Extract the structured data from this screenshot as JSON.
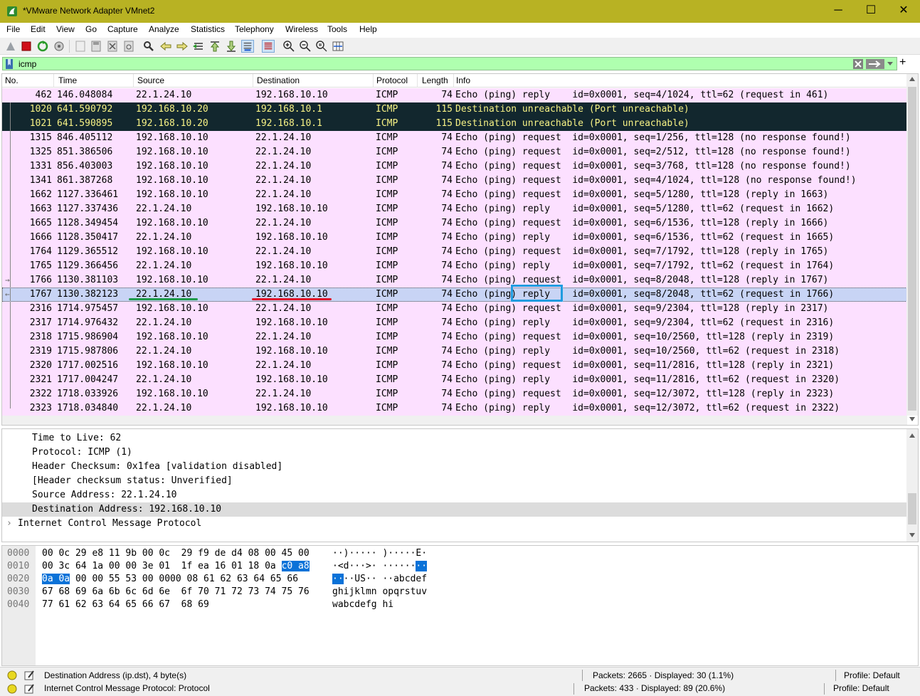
{
  "window": {
    "title": "*VMware Network Adapter VMnet2",
    "minimize": "─",
    "maximize": "☐",
    "close": "✕"
  },
  "menu": [
    "File",
    "Edit",
    "View",
    "Go",
    "Capture",
    "Analyze",
    "Statistics",
    "Telephony",
    "Wireless",
    "Tools",
    "Help"
  ],
  "filter": {
    "value": "icmp",
    "plus": "+"
  },
  "columns": [
    "No.",
    "Time",
    "Source",
    "Destination",
    "Protocol",
    "Length",
    "Info"
  ],
  "packets": [
    {
      "no": "462",
      "time": "146.048084",
      "src": "22.1.24.10",
      "dst": "192.168.10.10",
      "proto": "ICMP",
      "len": "74",
      "info": "Echo (ping) reply    id=0x0001, seq=4/1024, ttl=62 (request in 461)",
      "style": "pink"
    },
    {
      "no": "1020",
      "time": "641.590792",
      "src": "192.168.10.20",
      "dst": "192.168.10.1",
      "proto": "ICMP",
      "len": "115",
      "info": "Destination unreachable (Port unreachable)",
      "style": "dark"
    },
    {
      "no": "1021",
      "time": "641.590895",
      "src": "192.168.10.20",
      "dst": "192.168.10.1",
      "proto": "ICMP",
      "len": "115",
      "info": "Destination unreachable (Port unreachable)",
      "style": "dark"
    },
    {
      "no": "1315",
      "time": "846.405112",
      "src": "192.168.10.10",
      "dst": "22.1.24.10",
      "proto": "ICMP",
      "len": "74",
      "info": "Echo (ping) request  id=0x0001, seq=1/256, ttl=128 (no response found!)",
      "style": "pink"
    },
    {
      "no": "1325",
      "time": "851.386506",
      "src": "192.168.10.10",
      "dst": "22.1.24.10",
      "proto": "ICMP",
      "len": "74",
      "info": "Echo (ping) request  id=0x0001, seq=2/512, ttl=128 (no response found!)",
      "style": "pink"
    },
    {
      "no": "1331",
      "time": "856.403003",
      "src": "192.168.10.10",
      "dst": "22.1.24.10",
      "proto": "ICMP",
      "len": "74",
      "info": "Echo (ping) request  id=0x0001, seq=3/768, ttl=128 (no response found!)",
      "style": "pink"
    },
    {
      "no": "1341",
      "time": "861.387268",
      "src": "192.168.10.10",
      "dst": "22.1.24.10",
      "proto": "ICMP",
      "len": "74",
      "info": "Echo (ping) request  id=0x0001, seq=4/1024, ttl=128 (no response found!)",
      "style": "pink"
    },
    {
      "no": "1662",
      "time": "1127.336461",
      "src": "192.168.10.10",
      "dst": "22.1.24.10",
      "proto": "ICMP",
      "len": "74",
      "info": "Echo (ping) request  id=0x0001, seq=5/1280, ttl=128 (reply in 1663)",
      "style": "pink"
    },
    {
      "no": "1663",
      "time": "1127.337436",
      "src": "22.1.24.10",
      "dst": "192.168.10.10",
      "proto": "ICMP",
      "len": "74",
      "info": "Echo (ping) reply    id=0x0001, seq=5/1280, ttl=62 (request in 1662)",
      "style": "pink"
    },
    {
      "no": "1665",
      "time": "1128.349454",
      "src": "192.168.10.10",
      "dst": "22.1.24.10",
      "proto": "ICMP",
      "len": "74",
      "info": "Echo (ping) request  id=0x0001, seq=6/1536, ttl=128 (reply in 1666)",
      "style": "pink"
    },
    {
      "no": "1666",
      "time": "1128.350417",
      "src": "22.1.24.10",
      "dst": "192.168.10.10",
      "proto": "ICMP",
      "len": "74",
      "info": "Echo (ping) reply    id=0x0001, seq=6/1536, ttl=62 (request in 1665)",
      "style": "pink"
    },
    {
      "no": "1764",
      "time": "1129.365512",
      "src": "192.168.10.10",
      "dst": "22.1.24.10",
      "proto": "ICMP",
      "len": "74",
      "info": "Echo (ping) request  id=0x0001, seq=7/1792, ttl=128 (reply in 1765)",
      "style": "pink"
    },
    {
      "no": "1765",
      "time": "1129.366456",
      "src": "22.1.24.10",
      "dst": "192.168.10.10",
      "proto": "ICMP",
      "len": "74",
      "info": "Echo (ping) reply    id=0x0001, seq=7/1792, ttl=62 (request in 1764)",
      "style": "pink"
    },
    {
      "no": "1766",
      "time": "1130.381103",
      "src": "192.168.10.10",
      "dst": "22.1.24.10",
      "proto": "ICMP",
      "len": "74",
      "info": "Echo (ping) request  id=0x0001, seq=8/2048, ttl=128 (reply in 1767)",
      "style": "pink"
    },
    {
      "no": "1767",
      "time": "1130.382123",
      "src": "22.1.24.10",
      "dst": "192.168.10.10",
      "proto": "ICMP",
      "len": "74",
      "info": "Echo (ping) reply    id=0x0001, seq=8/2048, ttl=62 (request in 1766)",
      "style": "selected"
    },
    {
      "no": "2316",
      "time": "1714.975457",
      "src": "192.168.10.10",
      "dst": "22.1.24.10",
      "proto": "ICMP",
      "len": "74",
      "info": "Echo (ping) request  id=0x0001, seq=9/2304, ttl=128 (reply in 2317)",
      "style": "pink"
    },
    {
      "no": "2317",
      "time": "1714.976432",
      "src": "22.1.24.10",
      "dst": "192.168.10.10",
      "proto": "ICMP",
      "len": "74",
      "info": "Echo (ping) reply    id=0x0001, seq=9/2304, ttl=62 (request in 2316)",
      "style": "pink"
    },
    {
      "no": "2318",
      "time": "1715.986904",
      "src": "192.168.10.10",
      "dst": "22.1.24.10",
      "proto": "ICMP",
      "len": "74",
      "info": "Echo (ping) request  id=0x0001, seq=10/2560, ttl=128 (reply in 2319)",
      "style": "pink"
    },
    {
      "no": "2319",
      "time": "1715.987806",
      "src": "22.1.24.10",
      "dst": "192.168.10.10",
      "proto": "ICMP",
      "len": "74",
      "info": "Echo (ping) reply    id=0x0001, seq=10/2560, ttl=62 (request in 2318)",
      "style": "pink"
    },
    {
      "no": "2320",
      "time": "1717.002516",
      "src": "192.168.10.10",
      "dst": "22.1.24.10",
      "proto": "ICMP",
      "len": "74",
      "info": "Echo (ping) request  id=0x0001, seq=11/2816, ttl=128 (reply in 2321)",
      "style": "pink"
    },
    {
      "no": "2321",
      "time": "1717.004247",
      "src": "22.1.24.10",
      "dst": "192.168.10.10",
      "proto": "ICMP",
      "len": "74",
      "info": "Echo (ping) reply    id=0x0001, seq=11/2816, ttl=62 (request in 2320)",
      "style": "pink"
    },
    {
      "no": "2322",
      "time": "1718.033926",
      "src": "192.168.10.10",
      "dst": "22.1.24.10",
      "proto": "ICMP",
      "len": "74",
      "info": "Echo (ping) request  id=0x0001, seq=12/3072, ttl=128 (reply in 2323)",
      "style": "pink"
    },
    {
      "no": "2323",
      "time": "1718.034840",
      "src": "22.1.24.10",
      "dst": "192.168.10.10",
      "proto": "ICMP",
      "len": "74",
      "info": "Echo (ping) reply    id=0x0001, seq=12/3072, ttl=62 (request in 2322)",
      "style": "pink"
    }
  ],
  "details": [
    {
      "text": "Time to Live: 62",
      "indent": 1,
      "selected": false
    },
    {
      "text": "Protocol: ICMP (1)",
      "indent": 1,
      "selected": false
    },
    {
      "text": "Header Checksum: 0x1fea [validation disabled]",
      "indent": 1,
      "selected": false
    },
    {
      "text": "[Header checksum status: Unverified]",
      "indent": 1,
      "selected": false
    },
    {
      "text": "Source Address: 22.1.24.10",
      "indent": 1,
      "selected": false
    },
    {
      "text": "Destination Address: 192.168.10.10",
      "indent": 1,
      "selected": true
    },
    {
      "text": "Internet Control Message Protocol",
      "indent": 0,
      "selected": false,
      "expander": "›"
    }
  ],
  "bytes": [
    {
      "offset": "0000",
      "hex": [
        [
          "00 0c 29 e8 11 9b 00 0c",
          ""
        ],
        [
          "29 f9 de d4 08 00 45 00",
          ""
        ]
      ],
      "ascii": [
        [
          "··)····· )·····E·",
          ""
        ]
      ]
    },
    {
      "offset": "0010",
      "hex": [
        [
          "00 3c 64 1a 00 00 3e 01",
          ""
        ],
        [
          "1f ea 16 01 18 0a ",
          ""
        ],
        [
          "c0 a8",
          "hl"
        ]
      ],
      "ascii": [
        [
          "·<d···>· ······",
          ""
        ],
        [
          "··",
          "hl"
        ]
      ]
    },
    {
      "offset": "0020",
      "hex": [
        [
          "0a 0a",
          "hl"
        ],
        [
          " 00 00 55 53 00 00",
          ""
        ],
        [
          "00 08 61 62 63 64 65 66",
          ""
        ]
      ],
      "ascii": [
        [
          "··",
          "hl"
        ],
        [
          "··US·· ··abcdef",
          ""
        ]
      ]
    },
    {
      "offset": "0030",
      "hex": [
        [
          "67 68 69 6a 6b 6c 6d 6e",
          ""
        ],
        [
          "6f 70 71 72 73 74 75 76",
          ""
        ]
      ],
      "ascii": [
        [
          "ghijklmn opqrstuv",
          ""
        ]
      ]
    },
    {
      "offset": "0040",
      "hex": [
        [
          "77 61 62 63 64 65 66 67",
          ""
        ],
        [
          "68 69",
          ""
        ]
      ],
      "ascii": [
        [
          "wabcdefg hi",
          ""
        ]
      ]
    }
  ],
  "status": {
    "field": "Destination Address (ip.dst), 4 byte(s)",
    "packets": "Packets: 2665 · Displayed: 30 (1.1%)",
    "profile": "Profile: Default"
  },
  "status2": {
    "field": "Internet Control Message Protocol: Protocol",
    "packets": "Packets: 433 · Displayed: 89 (20.6%)",
    "profile": "Profile: Default"
  },
  "colors": {
    "titlebar": "#b8b223",
    "pink_row": "#fce0ff",
    "dark_row_bg": "#12272e",
    "dark_row_fg": "#f7f285",
    "selected_row": "#c8d4f5",
    "filter_bg": "#afffaf",
    "annot_green": "#1f9a4a",
    "annot_red": "#e0142a",
    "annot_blue": "#1f9ce0"
  }
}
